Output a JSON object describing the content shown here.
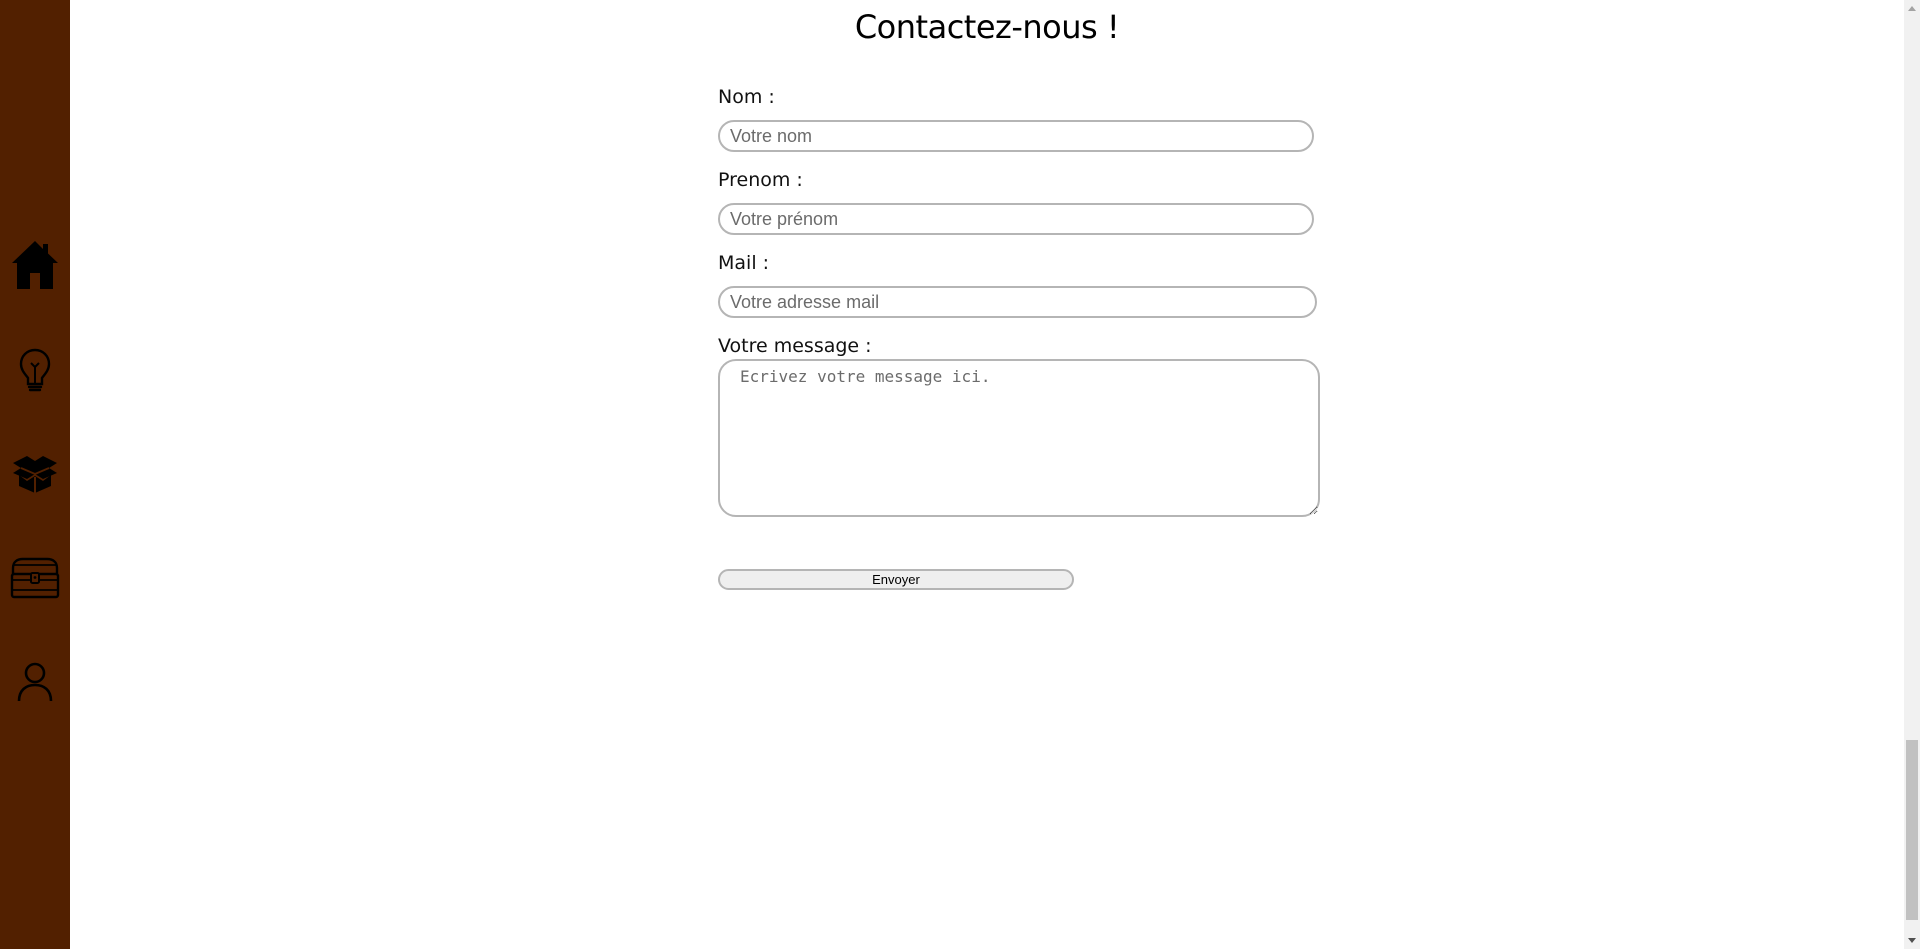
{
  "sidebar": {
    "items": [
      {
        "name": "home",
        "icon": "house-icon"
      },
      {
        "name": "ideas",
        "icon": "lightbulb-icon"
      },
      {
        "name": "products",
        "icon": "open-box-icon"
      },
      {
        "name": "treasure",
        "icon": "treasure-chest-icon"
      },
      {
        "name": "account",
        "icon": "user-icon"
      }
    ],
    "background_color": "#522000"
  },
  "main": {
    "title": "Contactez-nous !",
    "form": {
      "nom_label": "Nom :",
      "nom_placeholder": "Votre nom",
      "nom_value": "",
      "prenom_label": "Prenom :",
      "prenom_placeholder": "Votre prénom",
      "prenom_value": "",
      "mail_label": "Mail :",
      "mail_placeholder": "Votre adresse mail",
      "mail_value": "",
      "message_label": "Votre message :",
      "message_placeholder": "Ecrivez votre message ici.",
      "message_value": "",
      "submit_label": "Envoyer"
    }
  }
}
